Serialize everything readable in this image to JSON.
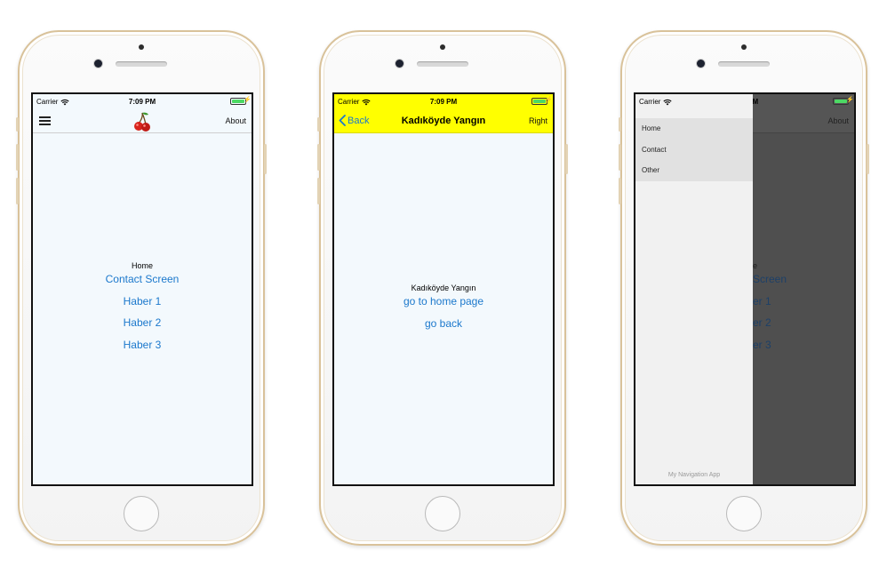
{
  "statusbar": {
    "carrier": "Carrier",
    "time": "7:09 PM"
  },
  "phone1": {
    "nav_right": "About",
    "menu_icon": "hamburger-menu-icon",
    "logo_icon": "cherry-icon",
    "screen_title": "Home",
    "links": [
      "Contact Screen",
      "Haber 1",
      "Haber 2",
      "Haber 3"
    ]
  },
  "phone2": {
    "back_label": "Back",
    "nav_title": "Kadıköyde Yangın",
    "nav_right": "Right",
    "screen_title": "Kadıköyde Yangın",
    "links": [
      "go to home page",
      "go back"
    ],
    "header_color": "#ffff00"
  },
  "phone3": {
    "nav_right": "About",
    "drawer_items": [
      "Home",
      "Contact",
      "Other"
    ],
    "drawer_footer": "My Navigation App",
    "visible_title_fragment": "e",
    "visible_link_fragments": [
      "Screen",
      "er 1",
      "er 2",
      "er 3"
    ]
  },
  "colors": {
    "link": "#1b78cc",
    "screen_bg": "#f3f9fd",
    "battery": "#4cd964",
    "frame_gold": "#d9c29a"
  }
}
